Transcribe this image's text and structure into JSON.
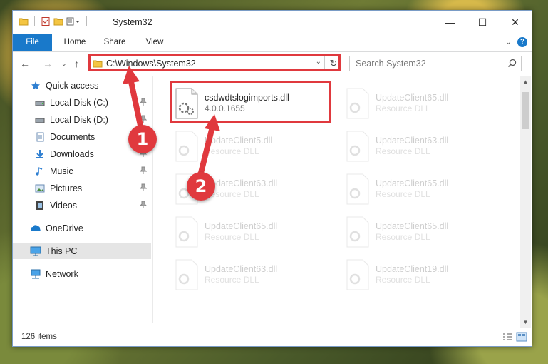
{
  "window": {
    "title": "System32",
    "controls": {
      "minimize": "—",
      "maximize": "☐",
      "close": "✕"
    }
  },
  "ribbon": {
    "tabs": [
      "File",
      "Home",
      "Share",
      "View"
    ],
    "help": "?"
  },
  "nav": {
    "address": "C:\\Windows\\System32",
    "search_placeholder": "Search System32"
  },
  "sidebar": {
    "items": [
      {
        "label": "Quick access",
        "icon": "star-icon",
        "pinned": false
      },
      {
        "label": "Local Disk (C:)",
        "icon": "drive-icon",
        "pinned": true
      },
      {
        "label": "Local Disk (D:)",
        "icon": "drive-icon",
        "pinned": true
      },
      {
        "label": "Documents",
        "icon": "documents-icon",
        "pinned": true
      },
      {
        "label": "Downloads",
        "icon": "downloads-icon",
        "pinned": true
      },
      {
        "label": "Music",
        "icon": "music-icon",
        "pinned": true
      },
      {
        "label": "Pictures",
        "icon": "pictures-icon",
        "pinned": true
      },
      {
        "label": "Videos",
        "icon": "videos-icon",
        "pinned": true
      },
      {
        "label": "OneDrive",
        "icon": "onedrive-icon",
        "pinned": false
      },
      {
        "label": "This PC",
        "icon": "pc-icon",
        "pinned": false,
        "selected": true
      },
      {
        "label": "Network",
        "icon": "network-icon",
        "pinned": false
      }
    ]
  },
  "files": [
    {
      "name": "csdwdtslogimports.dll",
      "type": "4.0.0.1655",
      "highlighted": true
    },
    {
      "name": "UpdateClient65.dll",
      "type": "Resource DLL"
    },
    {
      "name": "UpdateClient5.dll",
      "type": "Resource DLL"
    },
    {
      "name": "UpdateClient63.dll",
      "type": "Resource DLL"
    },
    {
      "name": "UpdateClient63.dll",
      "type": "Resource DLL"
    },
    {
      "name": "UpdateClient65.dll",
      "type": "Resource DLL"
    },
    {
      "name": "UpdateClient65.dll",
      "type": "Resource DLL"
    },
    {
      "name": "UpdateClient65.dll",
      "type": "Resource DLL"
    },
    {
      "name": "UpdateClient63.dll",
      "type": "Resource DLL"
    },
    {
      "name": "UpdateClient19.dll",
      "type": "Resource DLL"
    }
  ],
  "status": {
    "count": "126 items"
  },
  "annotations": {
    "step1": "1",
    "step2": "2",
    "color": "#e0393e"
  }
}
